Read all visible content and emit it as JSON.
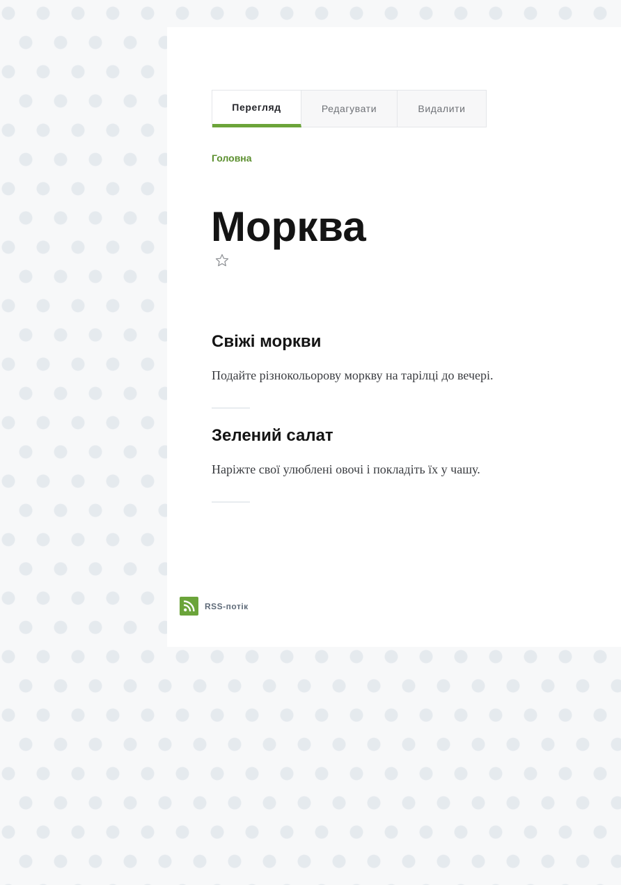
{
  "tabs": [
    {
      "label": "Перегляд",
      "active": true
    },
    {
      "label": "Редагувати",
      "active": false
    },
    {
      "label": "Видалити",
      "active": false
    }
  ],
  "breadcrumb": {
    "home": "Головна"
  },
  "page": {
    "title": "Морква",
    "favorite_icon": "star-outline-icon"
  },
  "articles": [
    {
      "title": "Свіжі моркви",
      "text": "Подайте різнокольорову моркву на тарілці до вечері."
    },
    {
      "title": "Зелений салат",
      "text": "Наріжте свої улюблені овочі і покладіть їх у чашу."
    }
  ],
  "feed": {
    "label": "RSS-потік",
    "icon": "rss-icon"
  },
  "colors": {
    "accent": "#6ba43a",
    "link": "#5b8f2e",
    "text": "#141414"
  }
}
